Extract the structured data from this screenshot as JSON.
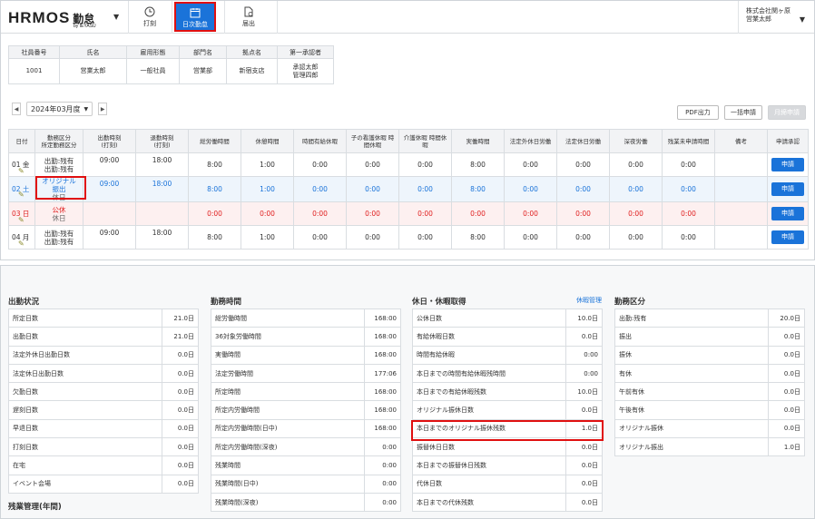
{
  "header": {
    "logo_text": "HRMOS",
    "logo_jp": "勤怠",
    "logo_by": "by IEYASU",
    "nav": [
      {
        "label": "打刻",
        "icon": "clock-icon"
      },
      {
        "label": "日次勤怠",
        "icon": "calendar-icon"
      },
      {
        "label": "届出",
        "icon": "document-icon"
      }
    ],
    "company": "株式会社関ヶ原",
    "user": "営業太郎"
  },
  "employee": {
    "headers": [
      "社員番号",
      "氏名",
      "雇用形態",
      "部門名",
      "拠点名",
      "第一承認者"
    ],
    "values": [
      "1001",
      "営業太郎",
      "一般社員",
      "営業部",
      "新宿支店"
    ],
    "approver_line1": "承認太郎",
    "approver_line2": "管理四郎"
  },
  "month_selector": {
    "value": "2024年03月度",
    "prev_icon": "chevron-left-icon",
    "next_icon": "chevron-right-icon"
  },
  "toolbar": {
    "pdf": "PDF出力",
    "bulk": "一括申請",
    "monthly": "月締申請"
  },
  "attendance": {
    "headers": {
      "date": "日付",
      "cat1": "勤務区分",
      "cat2": "所定勤務区分",
      "in1": "出勤時刻",
      "in2": "(打刻)",
      "out1": "退勤時刻",
      "out2": "(打刻)",
      "total": "総労働時間",
      "break": "休憩時間",
      "hourly": "時間有給休暇",
      "child1": "子の看護休暇 時",
      "child2": "間休暇",
      "care1": "介護休暇 時間休",
      "care2": "暇",
      "actual": "実働時間",
      "legalout": "法定外休日労働",
      "legal": "法定休日労働",
      "night": "深夜労働",
      "unreq": "残業未申請時間",
      "note": "備考",
      "apply": "申請承認"
    },
    "rows": [
      {
        "date": "01 金",
        "cat1": "出勤:残有",
        "cat2": "出勤:残有",
        "in": "09:00",
        "out": "18:00",
        "total": "8:00",
        "break": "1:00",
        "hourly": "0:00",
        "child": "0:00",
        "care": "0:00",
        "actual": "8:00",
        "legalout": "0:00",
        "legal": "0:00",
        "night": "0:00",
        "unreq": "0:00",
        "note": "",
        "btn": "申請"
      },
      {
        "date": "02 土",
        "cat1": "オリジナル振出",
        "cat2": "休日",
        "in": "09:00",
        "out": "18:00",
        "total": "8:00",
        "break": "1:00",
        "hourly": "0:00",
        "child": "0:00",
        "care": "0:00",
        "actual": "8:00",
        "legalout": "0:00",
        "legal": "0:00",
        "night": "0:00",
        "unreq": "0:00",
        "note": "",
        "btn": "申請"
      },
      {
        "date": "03 日",
        "cat1": "公休",
        "cat2": "休日",
        "in": "",
        "out": "",
        "total": "0:00",
        "break": "0:00",
        "hourly": "0:00",
        "child": "0:00",
        "care": "0:00",
        "actual": "0:00",
        "legalout": "0:00",
        "legal": "0:00",
        "night": "0:00",
        "unreq": "0:00",
        "note": "",
        "btn": "申請"
      },
      {
        "date": "04 月",
        "cat1": "出勤:残有",
        "cat2": "出勤:残有",
        "in": "09:00",
        "out": "18:00",
        "total": "8:00",
        "break": "1:00",
        "hourly": "0:00",
        "child": "0:00",
        "care": "0:00",
        "actual": "8:00",
        "legalout": "0:00",
        "legal": "0:00",
        "night": "0:00",
        "unreq": "0:00",
        "note": "",
        "btn": "申請"
      }
    ]
  },
  "summary": {
    "attendance_status": {
      "title": "出勤状況",
      "items": [
        [
          "所定日数",
          "21.0日"
        ],
        [
          "出勤日数",
          "21.0日"
        ],
        [
          "法定外休日出勤日数",
          "0.0日"
        ],
        [
          "法定休日出勤日数",
          "0.0日"
        ],
        [
          "欠勤日数",
          "0.0日"
        ],
        [
          "遅刻日数",
          "0.0日"
        ],
        [
          "早退日数",
          "0.0日"
        ],
        [
          "打刻日数",
          "0.0日"
        ],
        [
          "在宅",
          "0.0日"
        ],
        [
          "イベント会場",
          "0.0日"
        ]
      ]
    },
    "work_time": {
      "title": "勤務時間",
      "items": [
        [
          "総労働時間",
          "168:00"
        ],
        [
          "36対象労働時間",
          "168:00"
        ],
        [
          "実働時間",
          "168:00"
        ],
        [
          "法定労働時間",
          "177:06"
        ],
        [
          "所定時間",
          "168:00"
        ],
        [
          "所定内労働時間",
          "168:00"
        ],
        [
          "所定内労働時間(日中)",
          "168:00"
        ],
        [
          "所定内労働時間(深夜)",
          "0:00"
        ],
        [
          "残業時間",
          "0:00"
        ],
        [
          "残業時間(日中)",
          "0:00"
        ],
        [
          "残業時間(深夜)",
          "0:00"
        ]
      ]
    },
    "leave": {
      "title": "休日・休暇取得",
      "link": "休暇管理",
      "items": [
        [
          "公休日数",
          "10.0日"
        ],
        [
          "有給休暇日数",
          "0.0日"
        ],
        [
          "時間有給休暇",
          "0:00"
        ],
        [
          "本日までの時間有給休暇残時間",
          "0:00"
        ],
        [
          "本日までの有給休暇残数",
          "10.0日"
        ],
        [
          "オリジナル振休日数",
          "0.0日"
        ],
        [
          "本日までのオリジナル振休残数",
          "1.0日"
        ],
        [
          "振替休日日数",
          "0.0日"
        ],
        [
          "本日までの振替休日残数",
          "0.0日"
        ],
        [
          "代休日数",
          "0.0日"
        ],
        [
          "本日までの代休残数",
          "0.0日"
        ]
      ]
    },
    "work_category": {
      "title": "勤務区分",
      "items": [
        [
          "出勤:残有",
          "20.0日"
        ],
        [
          "振出",
          "0.0日"
        ],
        [
          "振休",
          "0.0日"
        ],
        [
          "有休",
          "0.0日"
        ],
        [
          "午前有休",
          "0.0日"
        ],
        [
          "午後有休",
          "0.0日"
        ],
        [
          "オリジナル振休",
          "0.0日"
        ],
        [
          "オリジナル振出",
          "1.0日"
        ]
      ]
    },
    "overtime_title": "残業管理(年間)"
  }
}
